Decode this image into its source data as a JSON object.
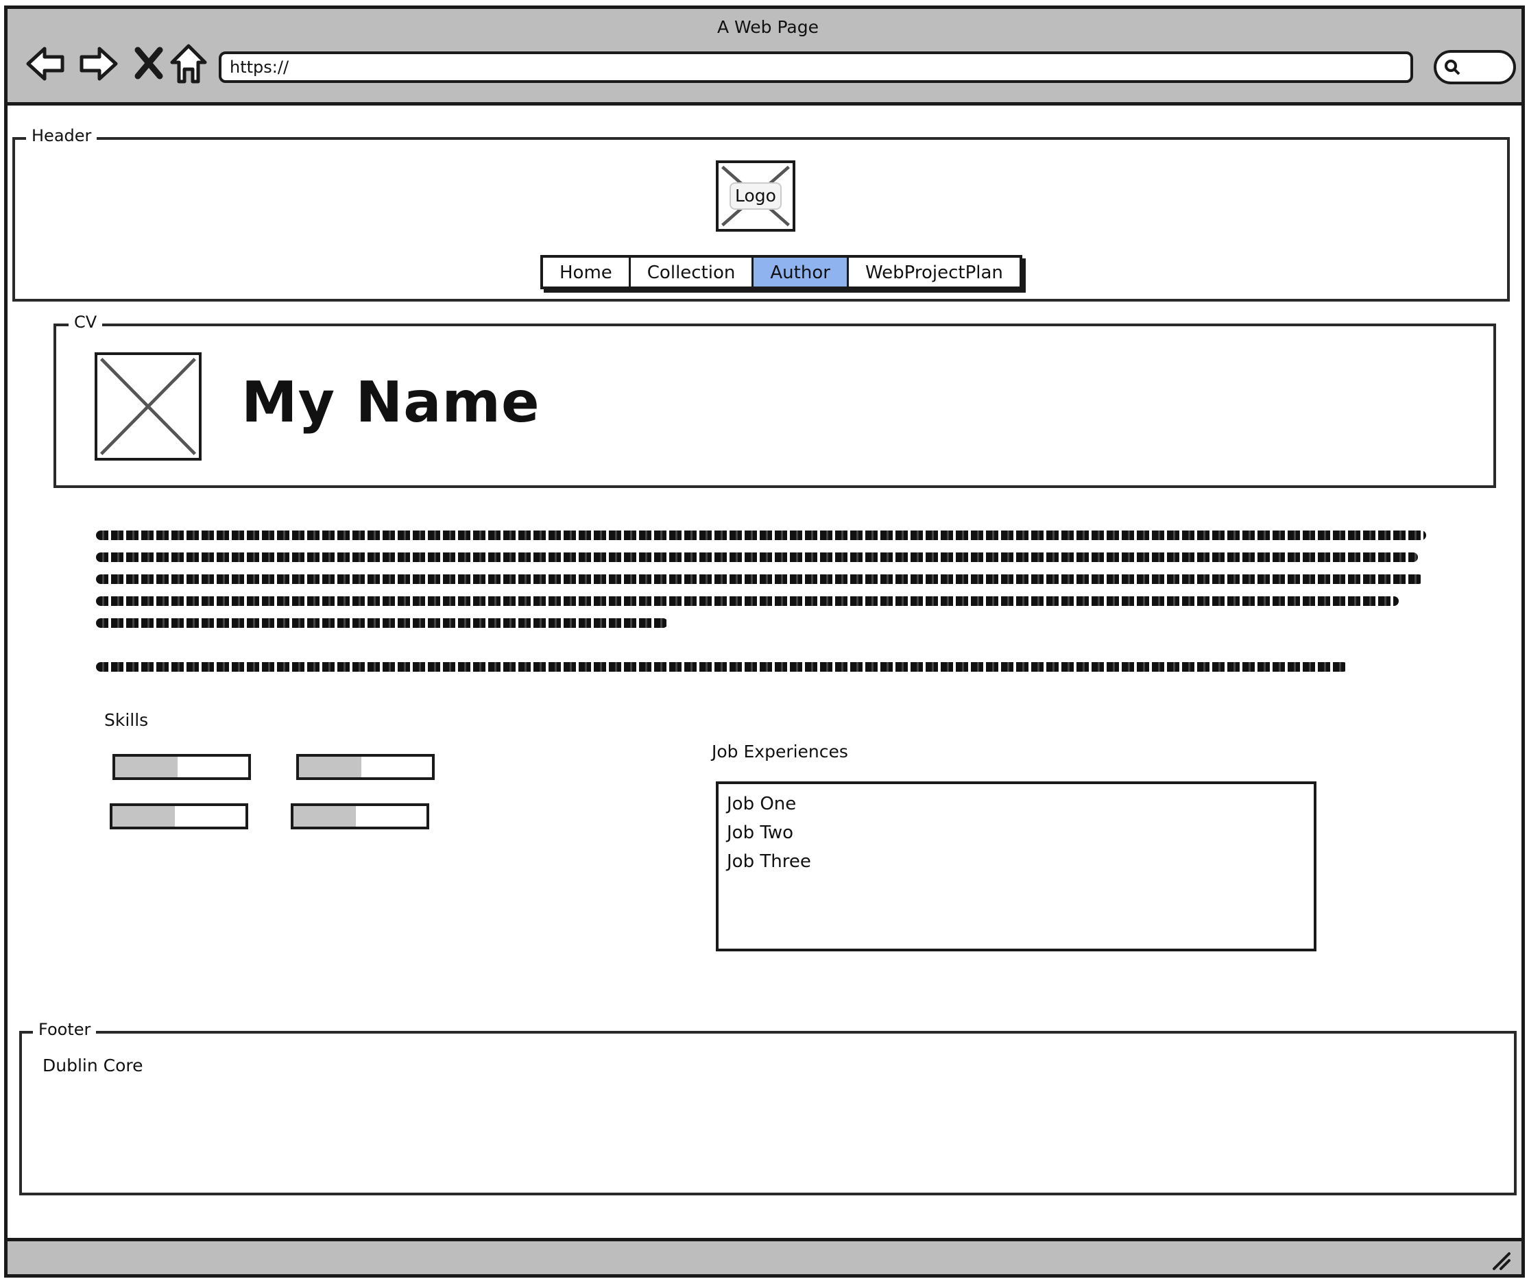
{
  "browser": {
    "title": "A Web Page",
    "url": "https://"
  },
  "header": {
    "legend": "Header",
    "logo_label": "Logo",
    "nav": [
      {
        "label": "Home",
        "active": false
      },
      {
        "label": "Collection",
        "active": false
      },
      {
        "label": "Author",
        "active": true
      },
      {
        "label": "WebProjectPlan",
        "active": false
      }
    ],
    "active_color": "#8fb3ef"
  },
  "cv": {
    "legend": "CV",
    "name": "My Name"
  },
  "skills": {
    "label": "Skills",
    "bars": [
      {
        "value": 0.47
      },
      {
        "value": 0.47
      },
      {
        "value": 0.47
      },
      {
        "value": 0.47
      }
    ]
  },
  "jobs": {
    "label": "Job Experiences",
    "items": [
      "Job One",
      "Job Two",
      "Job Three"
    ]
  },
  "footer": {
    "legend": "Footer",
    "text": "Dublin Core"
  }
}
